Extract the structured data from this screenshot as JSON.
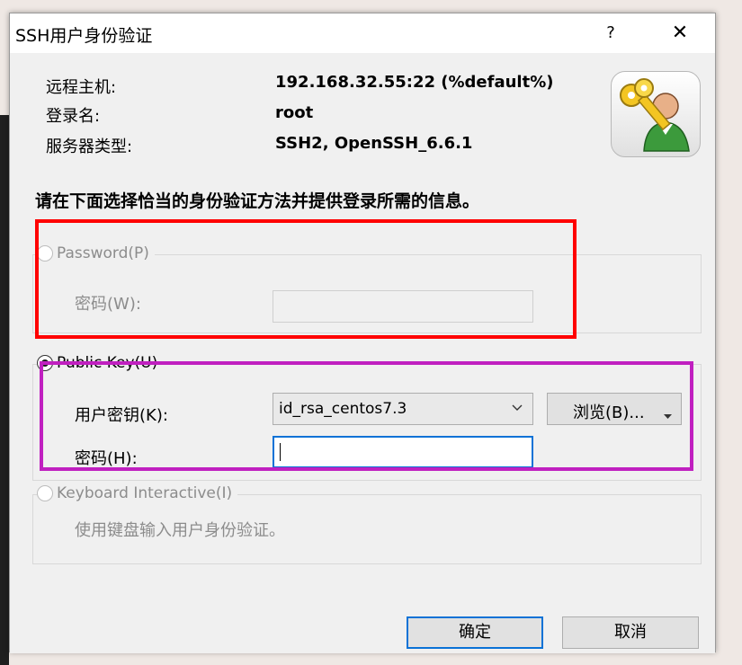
{
  "dialog": {
    "title": "SSH用户身份验证",
    "help_label": "?",
    "close_label": "✕"
  },
  "info": {
    "host_label": "远程主机:",
    "host_value": "192.168.32.55:22 (%default%)",
    "login_label": "登录名:",
    "login_value": "root",
    "server_type_label": "服务器类型:",
    "server_type_value": "SSH2, OpenSSH_6.6.1"
  },
  "heading": "请在下面选择恰当的身份验证方法并提供登录所需的信息。",
  "password_method": {
    "label": "Password(P)",
    "selected": false,
    "enabled": false,
    "password_label": "密码(W):",
    "password_value": ""
  },
  "public_key_method": {
    "label": "Public Key(U)",
    "selected": true,
    "user_key_label": "用户密钥(K):",
    "user_key_value": "id_rsa_centos7.3",
    "browse_label": "浏览(B)...",
    "passphrase_label": "密码(H):",
    "passphrase_value": ""
  },
  "keyboard_method": {
    "label": "Keyboard Interactive(I)",
    "selected": false,
    "enabled": false,
    "description": "使用键盘输入用户身份验证。"
  },
  "buttons": {
    "ok_label": "确定",
    "cancel_label": "取消"
  },
  "icons": {
    "dropdown": "chevron-down-icon",
    "browse_menu": "caret-down-icon",
    "keys": "key-user-icon"
  },
  "colors": {
    "highlight_red": "#ff0000",
    "highlight_magenta": "#c020c0",
    "focus_blue": "#0a72d6"
  }
}
